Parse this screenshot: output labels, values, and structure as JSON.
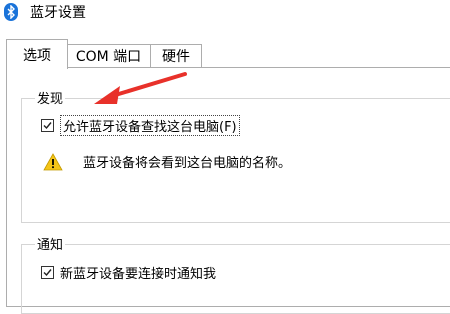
{
  "window": {
    "title": "蓝牙设置",
    "icon": "bluetooth-icon"
  },
  "tabs": [
    {
      "label": "选项",
      "active": true
    },
    {
      "label": "COM 端口",
      "active": false
    },
    {
      "label": "硬件",
      "active": false
    }
  ],
  "discovery": {
    "group_label": "发现",
    "allow_label": "允许蓝牙设备查找这台电脑(F)",
    "allow_checked": true,
    "warning_text": "蓝牙设备将会看到这台电脑的名称。",
    "warning_icon": "warning-icon"
  },
  "notifications": {
    "group_label": "通知",
    "notify_label": "新蓝牙设备要连接时通知我",
    "notify_checked": true
  },
  "colors": {
    "accent": "#1a73d9",
    "annotation_arrow": "#e8312a",
    "warning": "#f5c518"
  }
}
